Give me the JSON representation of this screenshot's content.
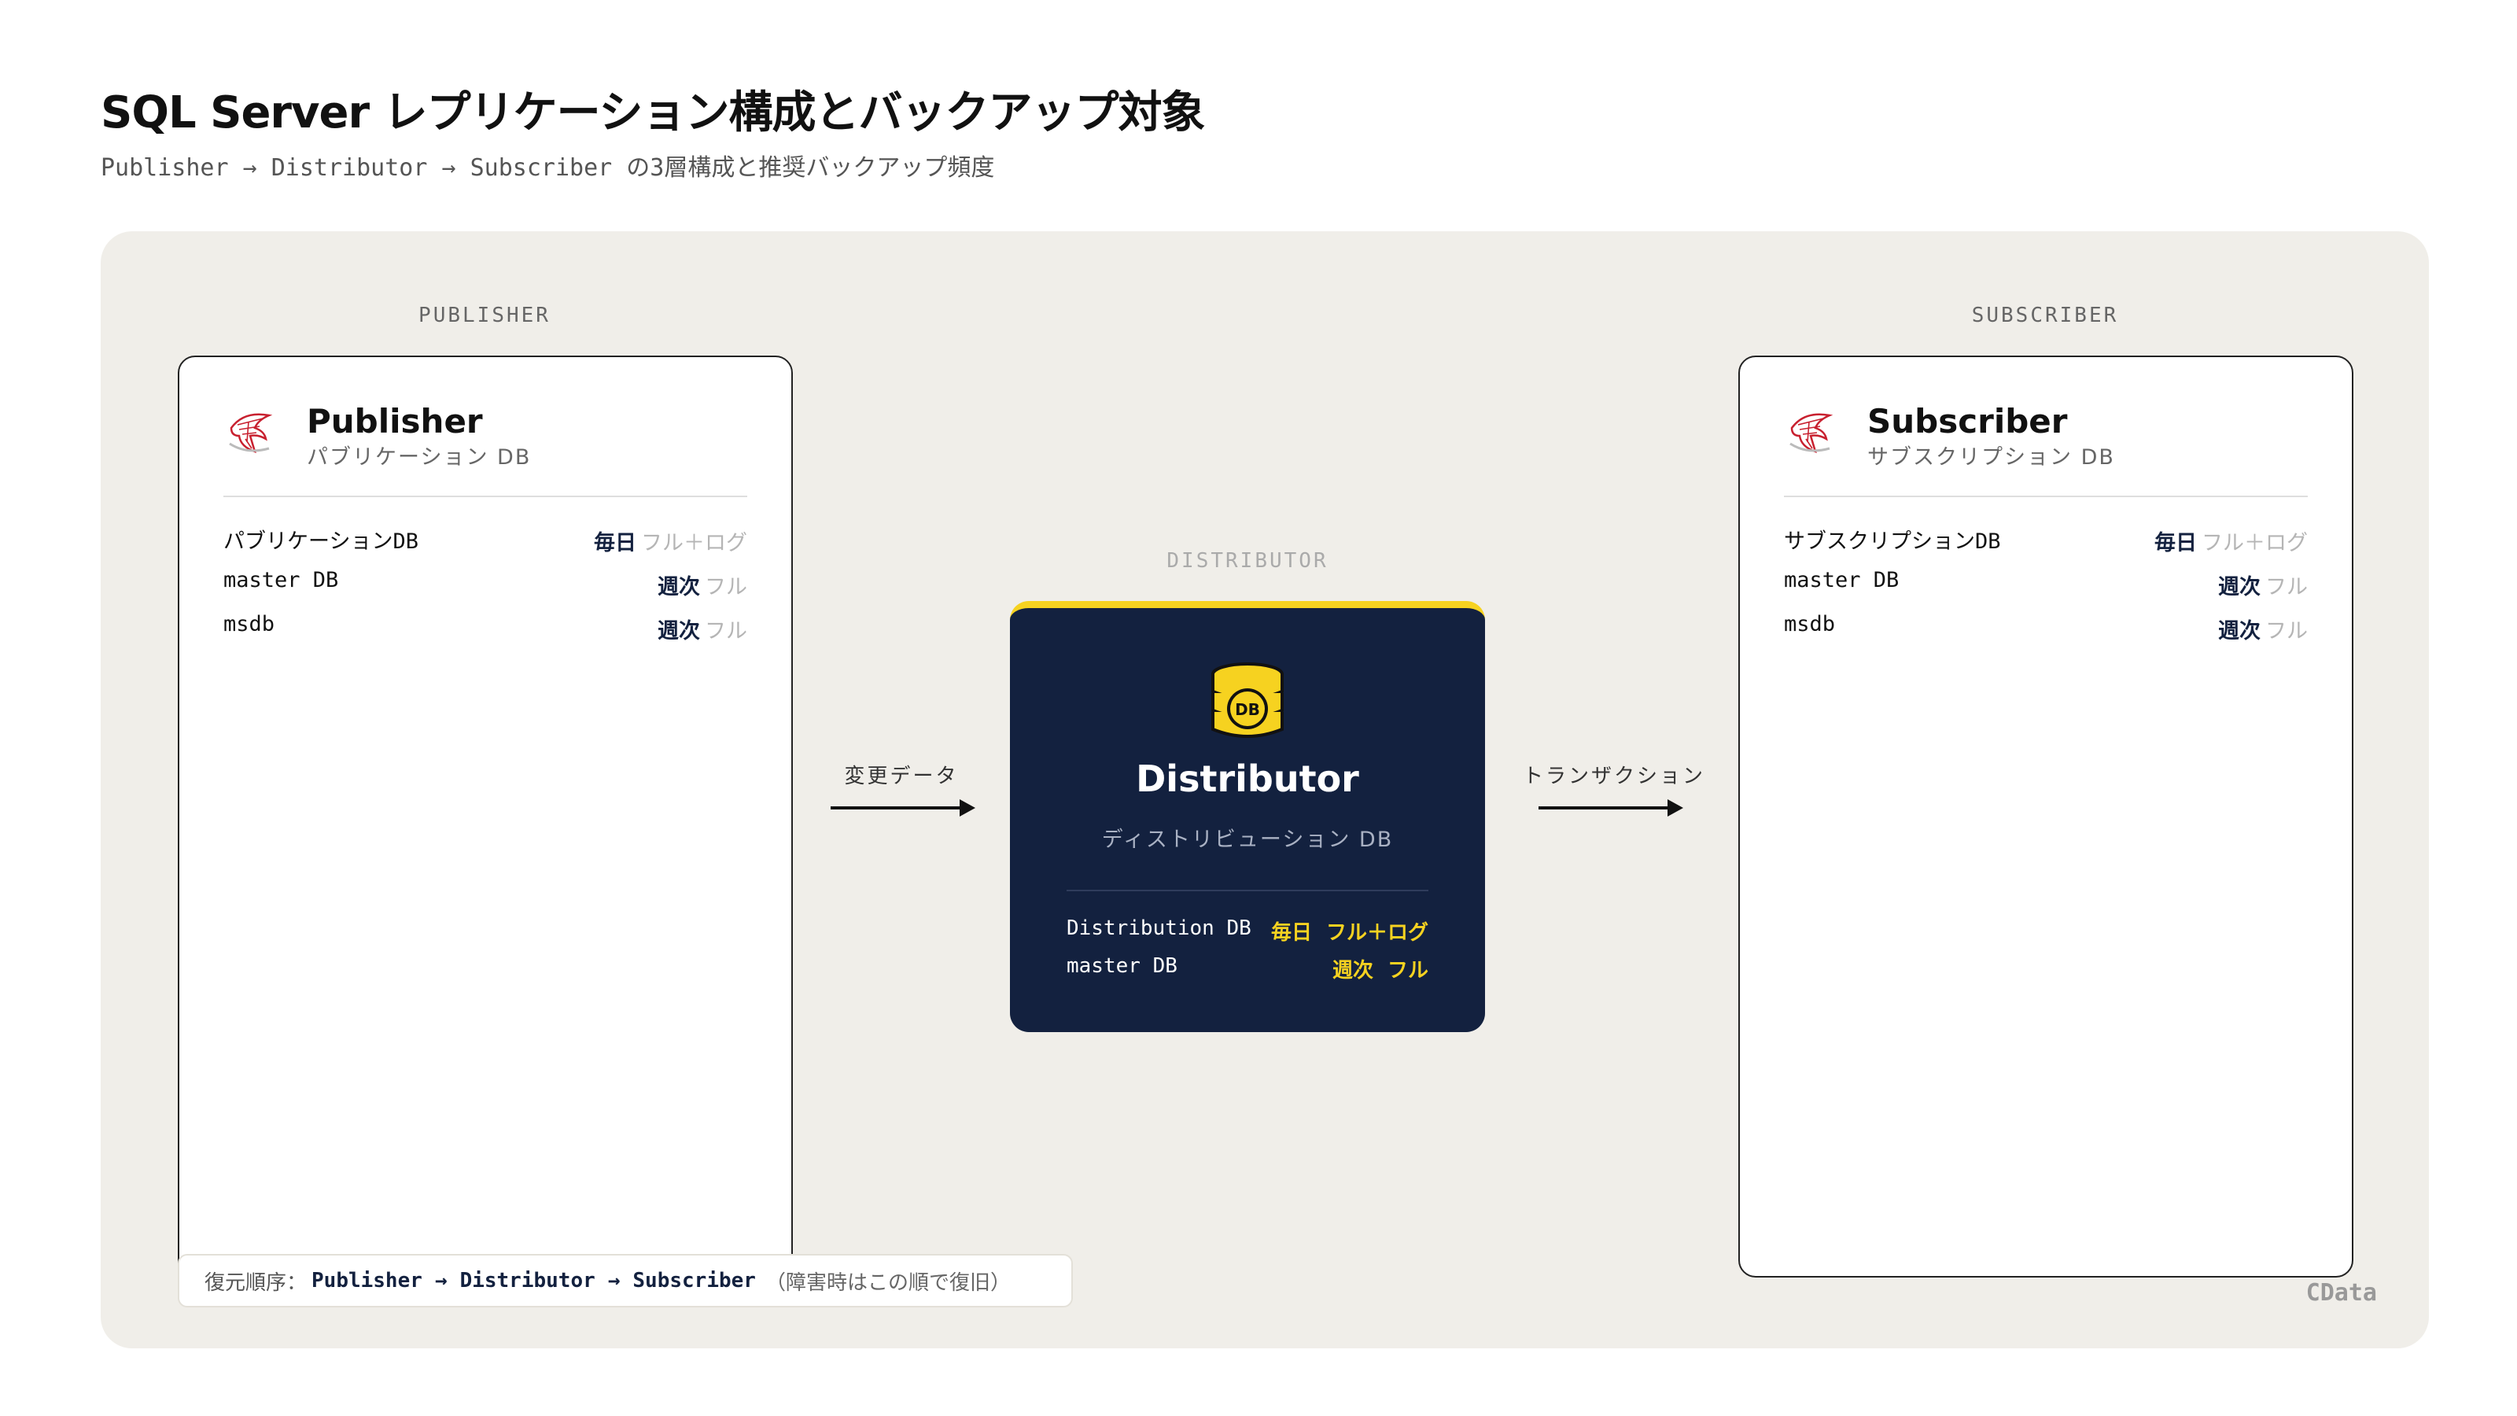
{
  "header": {
    "title": "SQL Server レプリケーション構成とバックアップ対象",
    "subtitle": "Publisher → Distributor → Subscriber の3層構成と推奨バックアップ頻度"
  },
  "columns": {
    "publisher_label": "PUBLISHER",
    "distributor_label": "DISTRIBUTOR",
    "subscriber_label": "SUBSCRIBER"
  },
  "publisher": {
    "icon": "sql-server-icon",
    "title": "Publisher",
    "subtitle": "パブリケーション DB",
    "rows": [
      {
        "name": "パブリケーションDB",
        "freq": "毎日",
        "type": "フル＋ログ"
      },
      {
        "name": "master DB",
        "freq": "週次",
        "type": "フル"
      },
      {
        "name": "msdb",
        "freq": "週次",
        "type": "フル"
      }
    ]
  },
  "distributor": {
    "icon": "database-icon",
    "icon_text": "DB",
    "title": "Distributor",
    "subtitle": "ディストリビューション DB",
    "rows": [
      {
        "name": "Distribution DB",
        "freq": "毎日",
        "type": "フル＋ログ"
      },
      {
        "name": "master DB",
        "freq": "週次",
        "type": "フル"
      }
    ]
  },
  "subscriber": {
    "icon": "sql-server-icon",
    "title": "Subscriber",
    "subtitle": "サブスクリプション DB",
    "rows": [
      {
        "name": "サブスクリプションDB",
        "freq": "毎日",
        "type": "フル＋ログ"
      },
      {
        "name": "master DB",
        "freq": "週次",
        "type": "フル"
      },
      {
        "name": "msdb",
        "freq": "週次",
        "type": "フル"
      }
    ]
  },
  "arrows": {
    "left_label": "変更データ",
    "right_label": "トランザクション"
  },
  "restore_order": {
    "label": "復元順序：",
    "steps": [
      "Publisher",
      "Distributor",
      "Subscriber"
    ],
    "separator": "→",
    "note": "（障害時はこの順で復旧）"
  },
  "brand": "CData",
  "colors": {
    "navy": "#13213f",
    "accent_yellow": "#f6d220",
    "panel_bg": "#f0eee9",
    "sql_red": "#c8202f"
  }
}
